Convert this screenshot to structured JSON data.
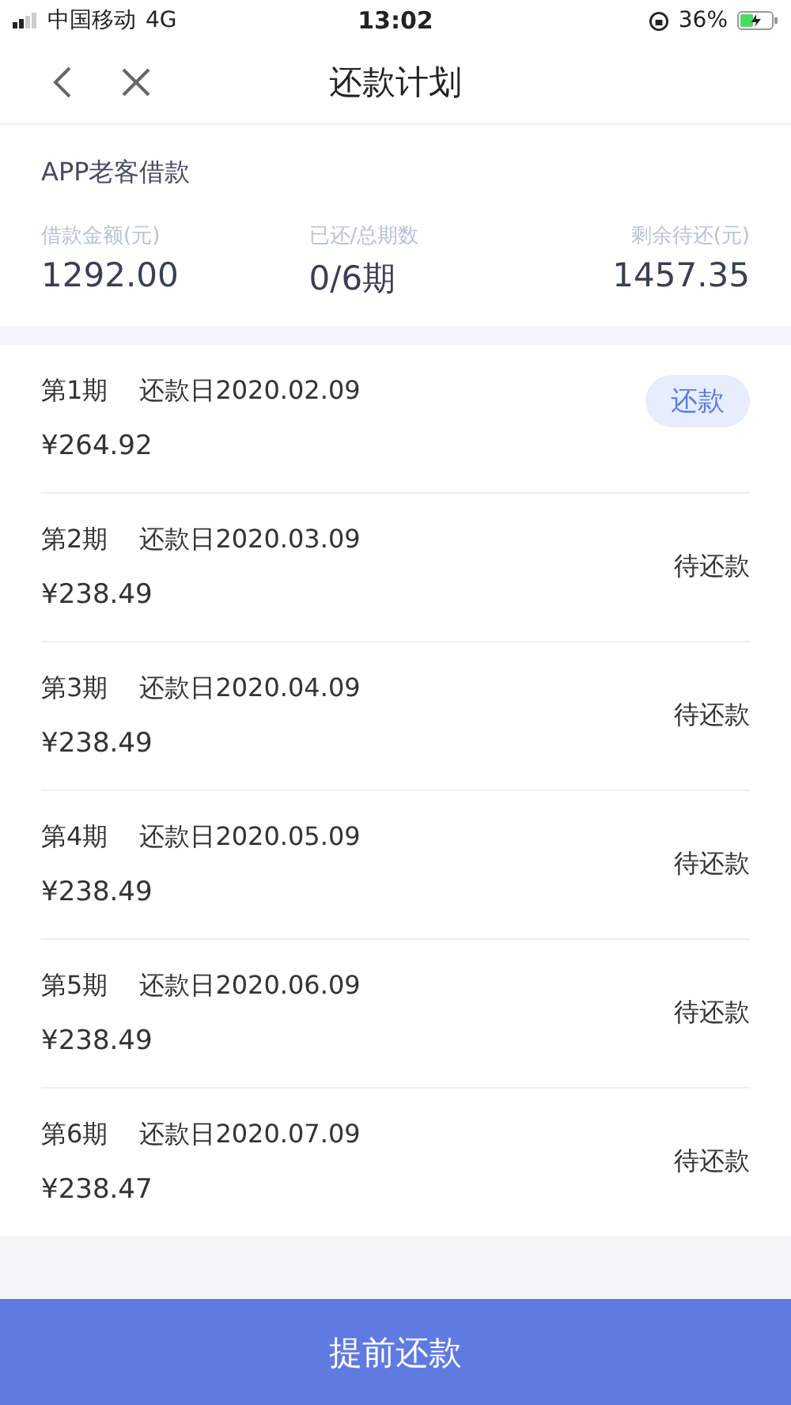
{
  "status_bar": {
    "carrier": "中国移动",
    "network": "4G",
    "time": "13:02",
    "battery": "36%"
  },
  "nav": {
    "title": "还款计划"
  },
  "summary": {
    "title": "APP老客借款",
    "stats": [
      {
        "label": "借款金额(元)",
        "value": "1292.00"
      },
      {
        "label": "已还/总期数",
        "value": "0/6期"
      },
      {
        "label": "剩余待还(元)",
        "value": "1457.35"
      }
    ]
  },
  "installments": [
    {
      "period": "第1期",
      "due": "还款日2020.02.09",
      "amount": "¥264.92",
      "action": "还款",
      "kind": "button"
    },
    {
      "period": "第2期",
      "due": "还款日2020.03.09",
      "amount": "¥238.49",
      "action": "待还款",
      "kind": "status"
    },
    {
      "period": "第3期",
      "due": "还款日2020.04.09",
      "amount": "¥238.49",
      "action": "待还款",
      "kind": "status"
    },
    {
      "period": "第4期",
      "due": "还款日2020.05.09",
      "amount": "¥238.49",
      "action": "待还款",
      "kind": "status"
    },
    {
      "period": "第5期",
      "due": "还款日2020.06.09",
      "amount": "¥238.49",
      "action": "待还款",
      "kind": "status"
    },
    {
      "period": "第6期",
      "due": "还款日2020.07.09",
      "amount": "¥238.47",
      "action": "待还款",
      "kind": "status"
    }
  ],
  "footer_button": "提前还款"
}
